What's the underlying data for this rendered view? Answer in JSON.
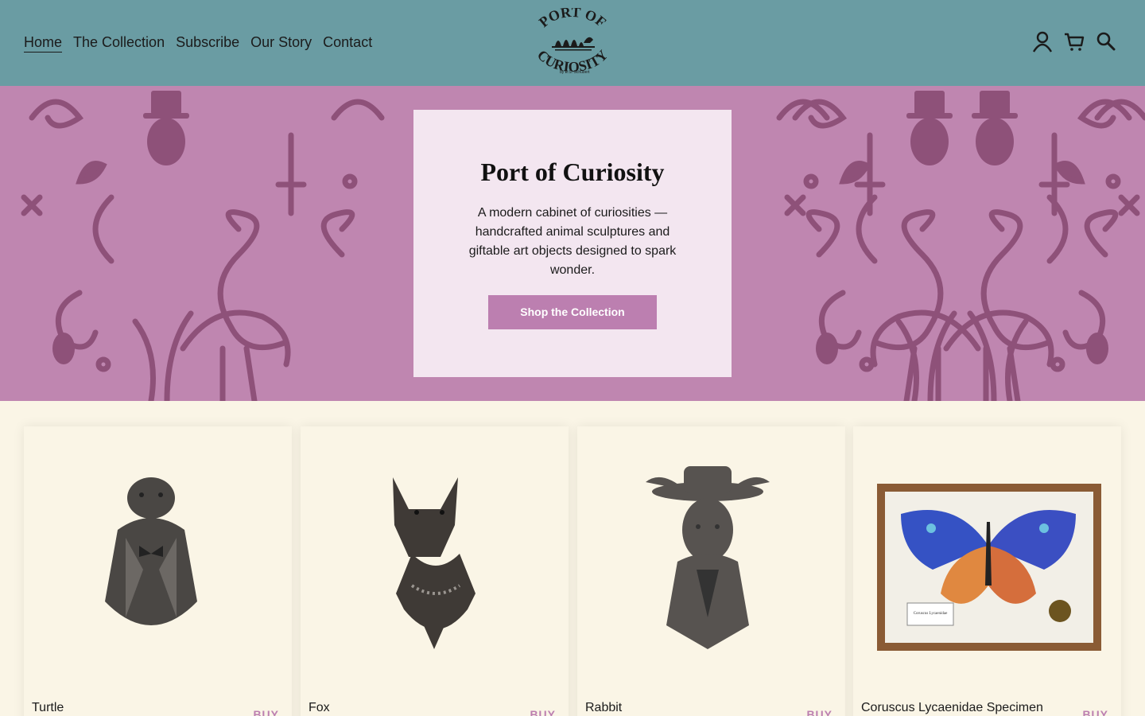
{
  "header": {
    "nav": [
      {
        "label": "Home",
        "active": true
      },
      {
        "label": "The Collection",
        "active": false
      },
      {
        "label": "Subscribe",
        "active": false
      },
      {
        "label": "Our Story",
        "active": false
      },
      {
        "label": "Contact",
        "active": false
      }
    ],
    "logo": {
      "top_text": "PORT OF",
      "bottom_text": "CURIOSITY",
      "byline": "by E.S. Schubert"
    },
    "icons": [
      "account-icon",
      "cart-icon",
      "search-icon"
    ]
  },
  "hero": {
    "title": "Port of Curiosity",
    "text": "A modern cabinet of curiosities — handcrafted animal sculptures and giftable art objects designed to spark wonder.",
    "button_label": "Shop the Collection"
  },
  "products": [
    {
      "name": "Turtle",
      "buy_label": "BUY",
      "image": "turtle-bust"
    },
    {
      "name": "Fox",
      "buy_label": "BUY",
      "image": "fox-bust"
    },
    {
      "name": "Rabbit",
      "buy_label": "BUY",
      "image": "rabbit-bust"
    },
    {
      "name": "Coruscus Lycaenidae Specimen",
      "buy_label": "BUY",
      "image": "butterfly-specimen",
      "specimen_label": "Coruscus Lycaenidae"
    }
  ],
  "colors": {
    "header_bg": "#6a9ca3",
    "hero_bg": "#bf86b0",
    "pattern": "#8e5179",
    "accent": "#bc7fb0",
    "page_bg": "#faf5e6"
  }
}
